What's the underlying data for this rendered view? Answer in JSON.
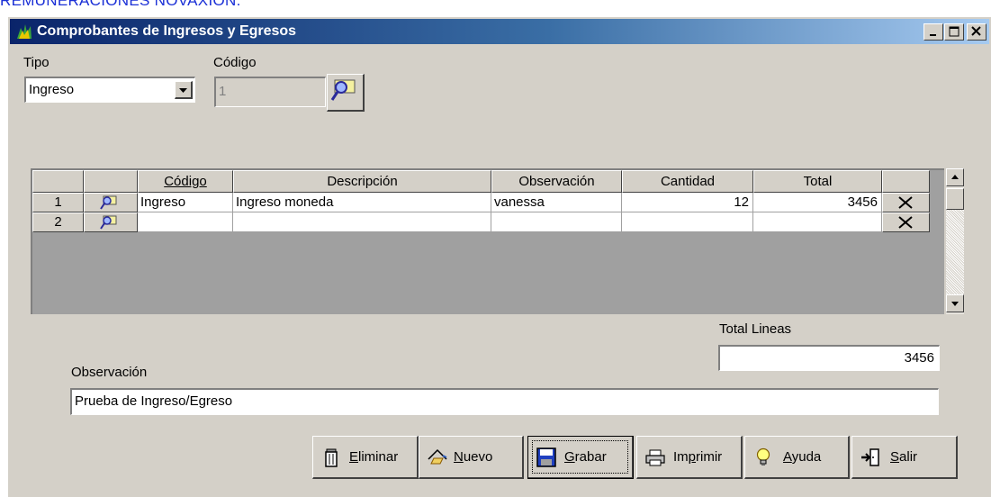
{
  "top_caption": "REMUNERACIONES NOVAXION.",
  "window": {
    "title": "Comprobantes de Ingresos y Egresos"
  },
  "form": {
    "tipo_label": "Tipo",
    "tipo_value": "Ingreso",
    "codigo_label": "Código",
    "codigo_value": "1",
    "total_lineas_label": "Total Lineas",
    "total_lineas_value": "3456",
    "observacion_label": "Observación",
    "observacion_value": "Prueba de Ingreso/Egreso"
  },
  "grid": {
    "columns": [
      "Código",
      "Descripción",
      "Observación",
      "Cantidad",
      "Total"
    ],
    "rows": [
      {
        "num": "1",
        "codigo": "Ingreso",
        "descripcion": "Ingreso moneda",
        "observacion": "vanessa",
        "cantidad": "12",
        "total": "3456"
      },
      {
        "num": "2",
        "codigo": "",
        "descripcion": "",
        "observacion": "",
        "cantidad": "",
        "total": ""
      }
    ]
  },
  "buttons": {
    "eliminar": {
      "pre": "",
      "u": "E",
      "post": "liminar"
    },
    "nuevo": {
      "pre": "",
      "u": "N",
      "post": "uevo"
    },
    "grabar": {
      "pre": "",
      "u": "G",
      "post": "rabar"
    },
    "imprimir": {
      "pre": "Im",
      "u": "p",
      "post": "rimir"
    },
    "ayuda": {
      "pre": "",
      "u": "A",
      "post": "yuda"
    },
    "salir": {
      "pre": "",
      "u": "S",
      "post": "alir"
    }
  },
  "colors": {
    "titlebar_start": "#0a246a",
    "titlebar_end": "#a6caf0",
    "caption_blue": "#1a2fd6",
    "window_face": "#d4d0c8"
  }
}
